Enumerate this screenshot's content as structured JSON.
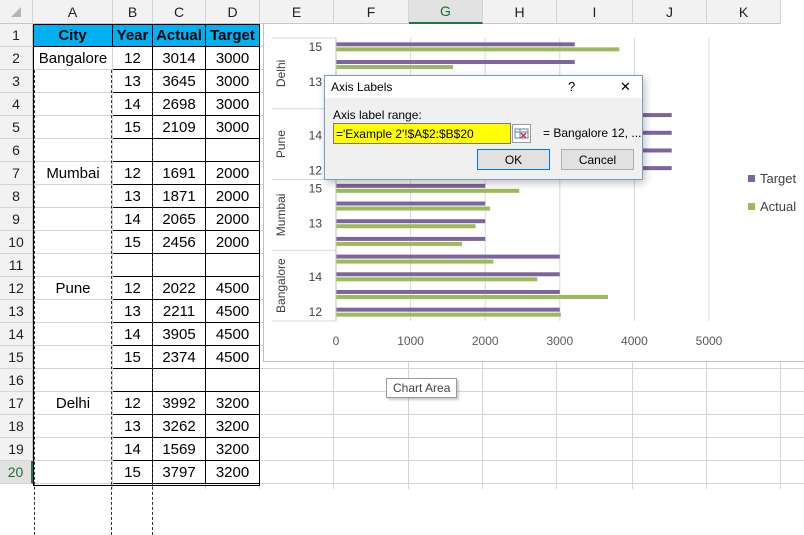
{
  "sheet": {
    "columns": [
      "A",
      "B",
      "C",
      "D",
      "E",
      "F",
      "G",
      "H",
      "I",
      "J",
      "K"
    ],
    "selected_column": "G",
    "rows": [
      "1",
      "2",
      "3",
      "4",
      "5",
      "6",
      "7",
      "8",
      "9",
      "10",
      "11",
      "12",
      "13",
      "14",
      "15",
      "16",
      "17",
      "18",
      "19",
      "20"
    ],
    "selected_row": "20",
    "header": {
      "city": "City",
      "year": "Year",
      "actual": "Actual",
      "target": "Target"
    },
    "data": [
      {
        "city": "Bangalore",
        "year": "12",
        "actual": "3014",
        "target": "3000"
      },
      {
        "city": "",
        "year": "13",
        "actual": "3645",
        "target": "3000"
      },
      {
        "city": "",
        "year": "14",
        "actual": "2698",
        "target": "3000"
      },
      {
        "city": "",
        "year": "15",
        "actual": "2109",
        "target": "3000"
      },
      {
        "city": "",
        "year": "",
        "actual": "",
        "target": ""
      },
      {
        "city": "Mumbai",
        "year": "12",
        "actual": "1691",
        "target": "2000"
      },
      {
        "city": "",
        "year": "13",
        "actual": "1871",
        "target": "2000"
      },
      {
        "city": "",
        "year": "14",
        "actual": "2065",
        "target": "2000"
      },
      {
        "city": "",
        "year": "15",
        "actual": "2456",
        "target": "2000"
      },
      {
        "city": "",
        "year": "",
        "actual": "",
        "target": ""
      },
      {
        "city": "Pune",
        "year": "12",
        "actual": "2022",
        "target": "4500"
      },
      {
        "city": "",
        "year": "13",
        "actual": "2211",
        "target": "4500"
      },
      {
        "city": "",
        "year": "14",
        "actual": "3905",
        "target": "4500"
      },
      {
        "city": "",
        "year": "15",
        "actual": "2374",
        "target": "4500"
      },
      {
        "city": "",
        "year": "",
        "actual": "",
        "target": ""
      },
      {
        "city": "Delhi",
        "year": "12",
        "actual": "3992",
        "target": "3200"
      },
      {
        "city": "",
        "year": "13",
        "actual": "3262",
        "target": "3200"
      },
      {
        "city": "",
        "year": "14",
        "actual": "1569",
        "target": "3200"
      },
      {
        "city": "",
        "year": "15",
        "actual": "3797",
        "target": "3200"
      }
    ]
  },
  "chart_data": {
    "type": "bar",
    "orientation": "horizontal",
    "groups": [
      {
        "name": "Bangalore",
        "years": [
          "12",
          "13",
          "14",
          "15"
        ],
        "actual": [
          3014,
          3645,
          2698,
          2109
        ],
        "target": [
          3000,
          3000,
          3000,
          3000
        ],
        "visible_year_labels": [
          "12",
          "14"
        ]
      },
      {
        "name": "Mumbai",
        "years": [
          "12",
          "13",
          "14",
          "15"
        ],
        "actual": [
          1691,
          1871,
          2065,
          2456
        ],
        "target": [
          2000,
          2000,
          2000,
          2000
        ],
        "visible_year_labels": [
          "13",
          "15"
        ]
      },
      {
        "name": "Pune",
        "years": [
          "12",
          "13",
          "14",
          "15"
        ],
        "actual": [
          2022,
          2211,
          3905,
          2374
        ],
        "target": [
          4500,
          4500,
          4500,
          4500
        ],
        "visible_year_labels": [
          "12",
          "14"
        ]
      },
      {
        "name": "Delhi",
        "years": [
          "12",
          "13",
          "14",
          "15"
        ],
        "actual": [
          3992,
          3262,
          1569,
          3797
        ],
        "target": [
          3200,
          3200,
          3200,
          3200
        ],
        "visible_year_labels": [
          "13",
          "15"
        ]
      }
    ],
    "series": [
      {
        "name": "Target",
        "color": "#7e649e"
      },
      {
        "name": "Actual",
        "color": "#9bbb59"
      }
    ],
    "x_ticks": [
      "0",
      "1000",
      "2000",
      "3000",
      "4000",
      "5000"
    ],
    "xlim": [
      0,
      5000
    ],
    "grid": true,
    "legend_position": "right",
    "tooltip": "Chart Area"
  },
  "dialog": {
    "title": "Axis Labels",
    "help": "?",
    "close": "✕",
    "field_label": "Axis label range:",
    "field_value": "='Example 2'!$A$2:$B$20",
    "preview": "= Bangalore 12, ...",
    "ok": "OK",
    "cancel": "Cancel",
    "accent": "#ffff00"
  }
}
